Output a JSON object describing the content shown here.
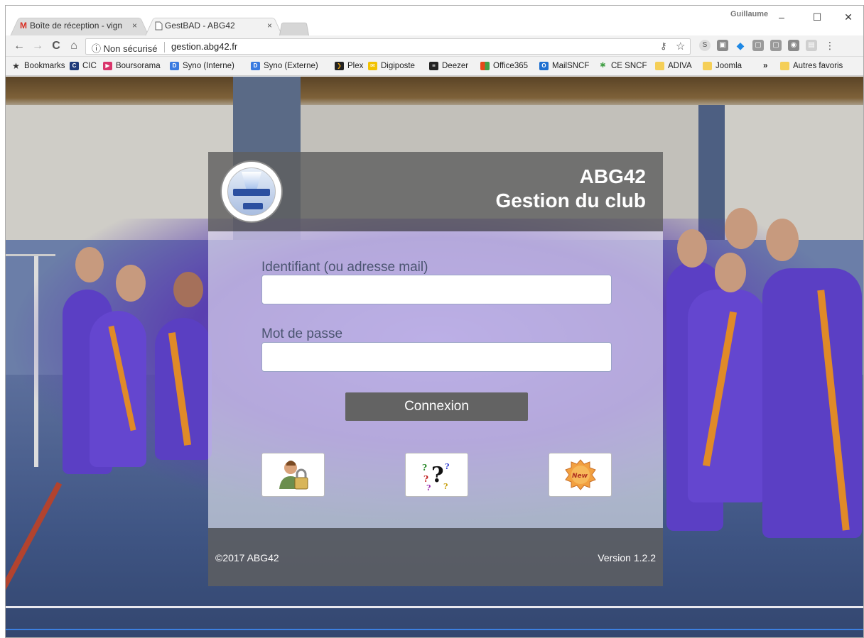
{
  "browser": {
    "tabs": [
      {
        "label": "Boîte de réception - vign",
        "icon": "gmail-icon",
        "close": "×"
      },
      {
        "label": "GestBAD - ABG42",
        "icon": "page-icon",
        "close": "×"
      }
    ],
    "window_user": "Guillaume",
    "window_controls": {
      "minimize": "–",
      "maximize": "☐",
      "close": "✕"
    },
    "nav": {
      "back": "←",
      "forward": "→",
      "reload": "C",
      "home": "⌂"
    },
    "address": {
      "security": "ⓘ Non sécurisé",
      "url": "gestion.abg42.fr"
    },
    "bookmarks": [
      {
        "label": "Bookmarks",
        "icon": "star-icon",
        "color": "#333333"
      },
      {
        "label": "CIC",
        "icon": "cic-icon",
        "color": "#1f3a7a"
      },
      {
        "label": "Boursorama",
        "icon": "boursorama-icon",
        "color": "#d9356b"
      },
      {
        "label": "Syno (Interne)",
        "icon": "dsm-icon",
        "color": "#3a7be0"
      },
      {
        "label": "Syno (Externe)",
        "icon": "dsm-icon",
        "color": "#3a7be0"
      },
      {
        "label": "Plex",
        "icon": "plex-icon",
        "color": "#e5a00d"
      },
      {
        "label": "Digiposte",
        "icon": "digiposte-icon",
        "color": "#f2c200"
      },
      {
        "label": "Deezer",
        "icon": "deezer-icon",
        "color": "#222222"
      },
      {
        "label": "Office365",
        "icon": "office-icon",
        "color": "#e64a19"
      },
      {
        "label": "MailSNCF",
        "icon": "outlook-icon",
        "color": "#1e6fd0"
      },
      {
        "label": "CE SNCF",
        "icon": "cesncf-icon",
        "color": "#43a047"
      },
      {
        "label": "ADIVA",
        "icon": "folder-icon",
        "color": "#f5cf57"
      },
      {
        "label": "Joomla",
        "icon": "folder-icon",
        "color": "#f5cf57"
      }
    ],
    "bookmarks_more": "»",
    "other_bookmarks": "Autres favoris"
  },
  "login": {
    "title_line1": "ABG42",
    "title_line2": "Gestion du club",
    "username_label": "Identifiant (ou adresse mail)",
    "username_value": "",
    "password_label": "Mot de passe",
    "password_value": "",
    "connect_label": "Connexion",
    "action_icons": [
      "user-lock-icon",
      "question-marks-icon",
      "new-badge-icon"
    ],
    "footer_left": "©2017 ABG42",
    "footer_right": "Version 1.2.2"
  }
}
